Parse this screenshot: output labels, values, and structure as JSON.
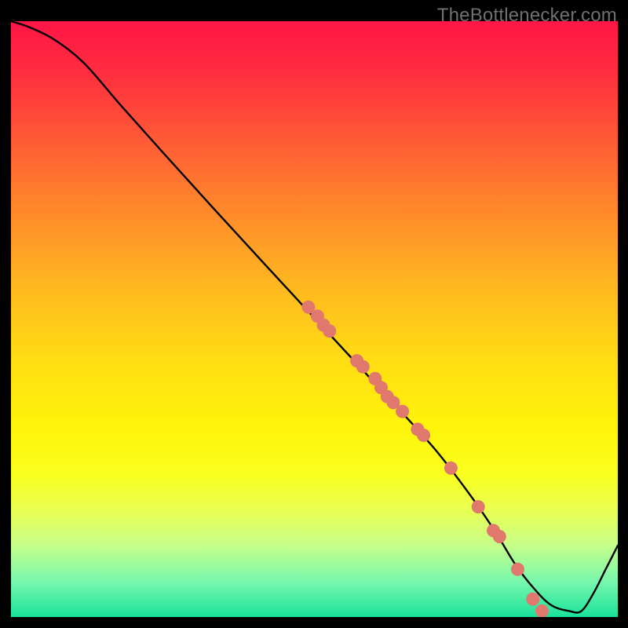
{
  "watermark": "TheBottlenecker.com",
  "chart_data": {
    "type": "line",
    "title": "",
    "xlabel": "",
    "ylabel": "",
    "xlim": [
      0,
      100
    ],
    "ylim": [
      0,
      100
    ],
    "x": [
      0,
      3,
      7,
      12,
      18,
      25,
      33,
      42,
      52,
      62,
      70,
      76,
      80,
      83,
      86,
      89,
      92,
      94,
      96,
      98,
      100
    ],
    "series": [
      {
        "name": "curve",
        "values": [
          100,
          99,
          97,
          93,
          86,
          78,
          69,
          59,
          48,
          37,
          28,
          20,
          14,
          9,
          5,
          2,
          1,
          1,
          4,
          8,
          12
        ]
      }
    ],
    "markers_x": [
      49,
      50.5,
      51.5,
      52.5,
      57,
      58,
      60,
      61,
      62,
      63,
      64.5,
      67,
      68,
      72.5,
      77,
      79.5,
      80.5,
      83.5,
      86,
      87.5
    ],
    "markers_y": [
      52,
      50.5,
      49,
      48,
      43,
      42,
      40,
      38.5,
      37,
      36,
      34.5,
      31.5,
      30.5,
      25,
      18.5,
      14.5,
      13.5,
      8,
      3,
      1
    ],
    "marker_color": "#e0786e",
    "gradient": [
      "#ff1647",
      "#ffdb14",
      "#faff1d",
      "#19e29a"
    ]
  }
}
